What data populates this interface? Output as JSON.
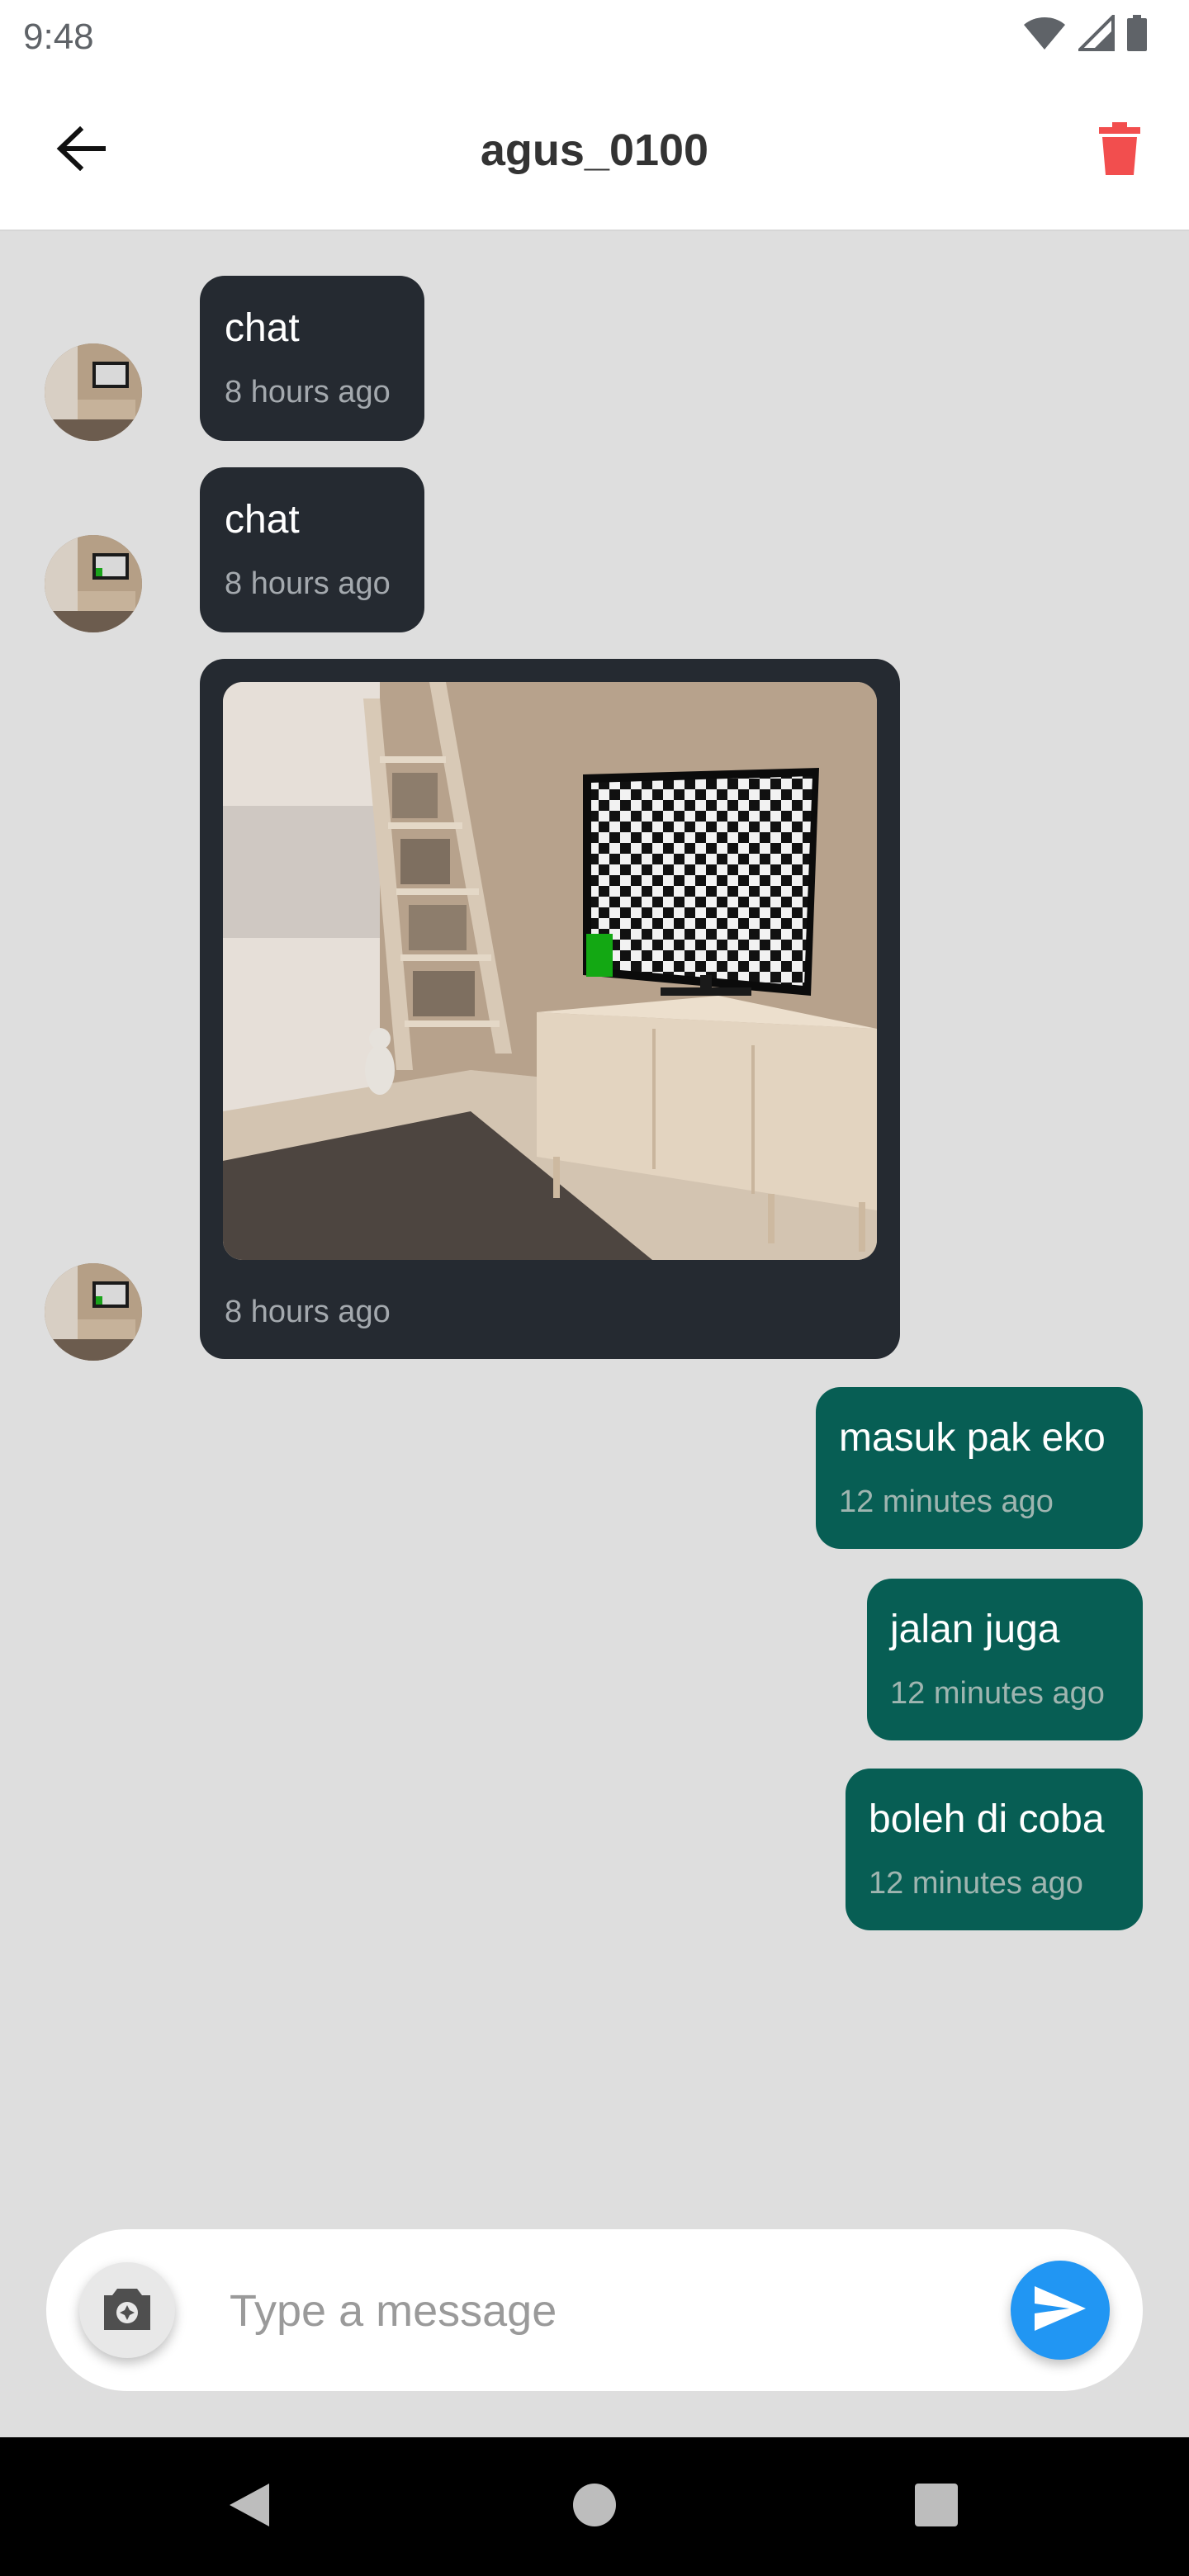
{
  "status_bar": {
    "time": "9:48",
    "icons": [
      "wifi-icon",
      "cellular-signal-icon",
      "battery-icon"
    ]
  },
  "header": {
    "title": "agus_0100",
    "back_icon": "arrow-left-icon",
    "delete_icon": "trash-icon"
  },
  "messages": [
    {
      "direction": "incoming",
      "type": "text",
      "text": "chat",
      "time": "8 hours ago"
    },
    {
      "direction": "incoming",
      "type": "text",
      "text": "chat",
      "time": "8 hours ago"
    },
    {
      "direction": "incoming",
      "type": "image",
      "time": "8 hours ago"
    },
    {
      "direction": "outgoing",
      "type": "text",
      "text": "masuk pak eko",
      "time": "12 minutes ago"
    },
    {
      "direction": "outgoing",
      "type": "text",
      "text": "jalan juga",
      "time": "12 minutes ago"
    },
    {
      "direction": "outgoing",
      "type": "text",
      "text": "boleh di coba",
      "time": "12 minutes ago"
    }
  ],
  "composer": {
    "placeholder": "Type a message",
    "value": "",
    "camera_icon": "camera-icon",
    "send_icon": "send-icon"
  },
  "nav": {
    "buttons": [
      "back-triangle-icon",
      "home-circle-icon",
      "recents-square-icon"
    ]
  },
  "colors": {
    "incoming_bubble": "#252a31",
    "outgoing_bubble": "#075e54",
    "chat_background": "#dedede",
    "delete_accent": "#f24e4e",
    "send_accent": "#2196f3"
  }
}
